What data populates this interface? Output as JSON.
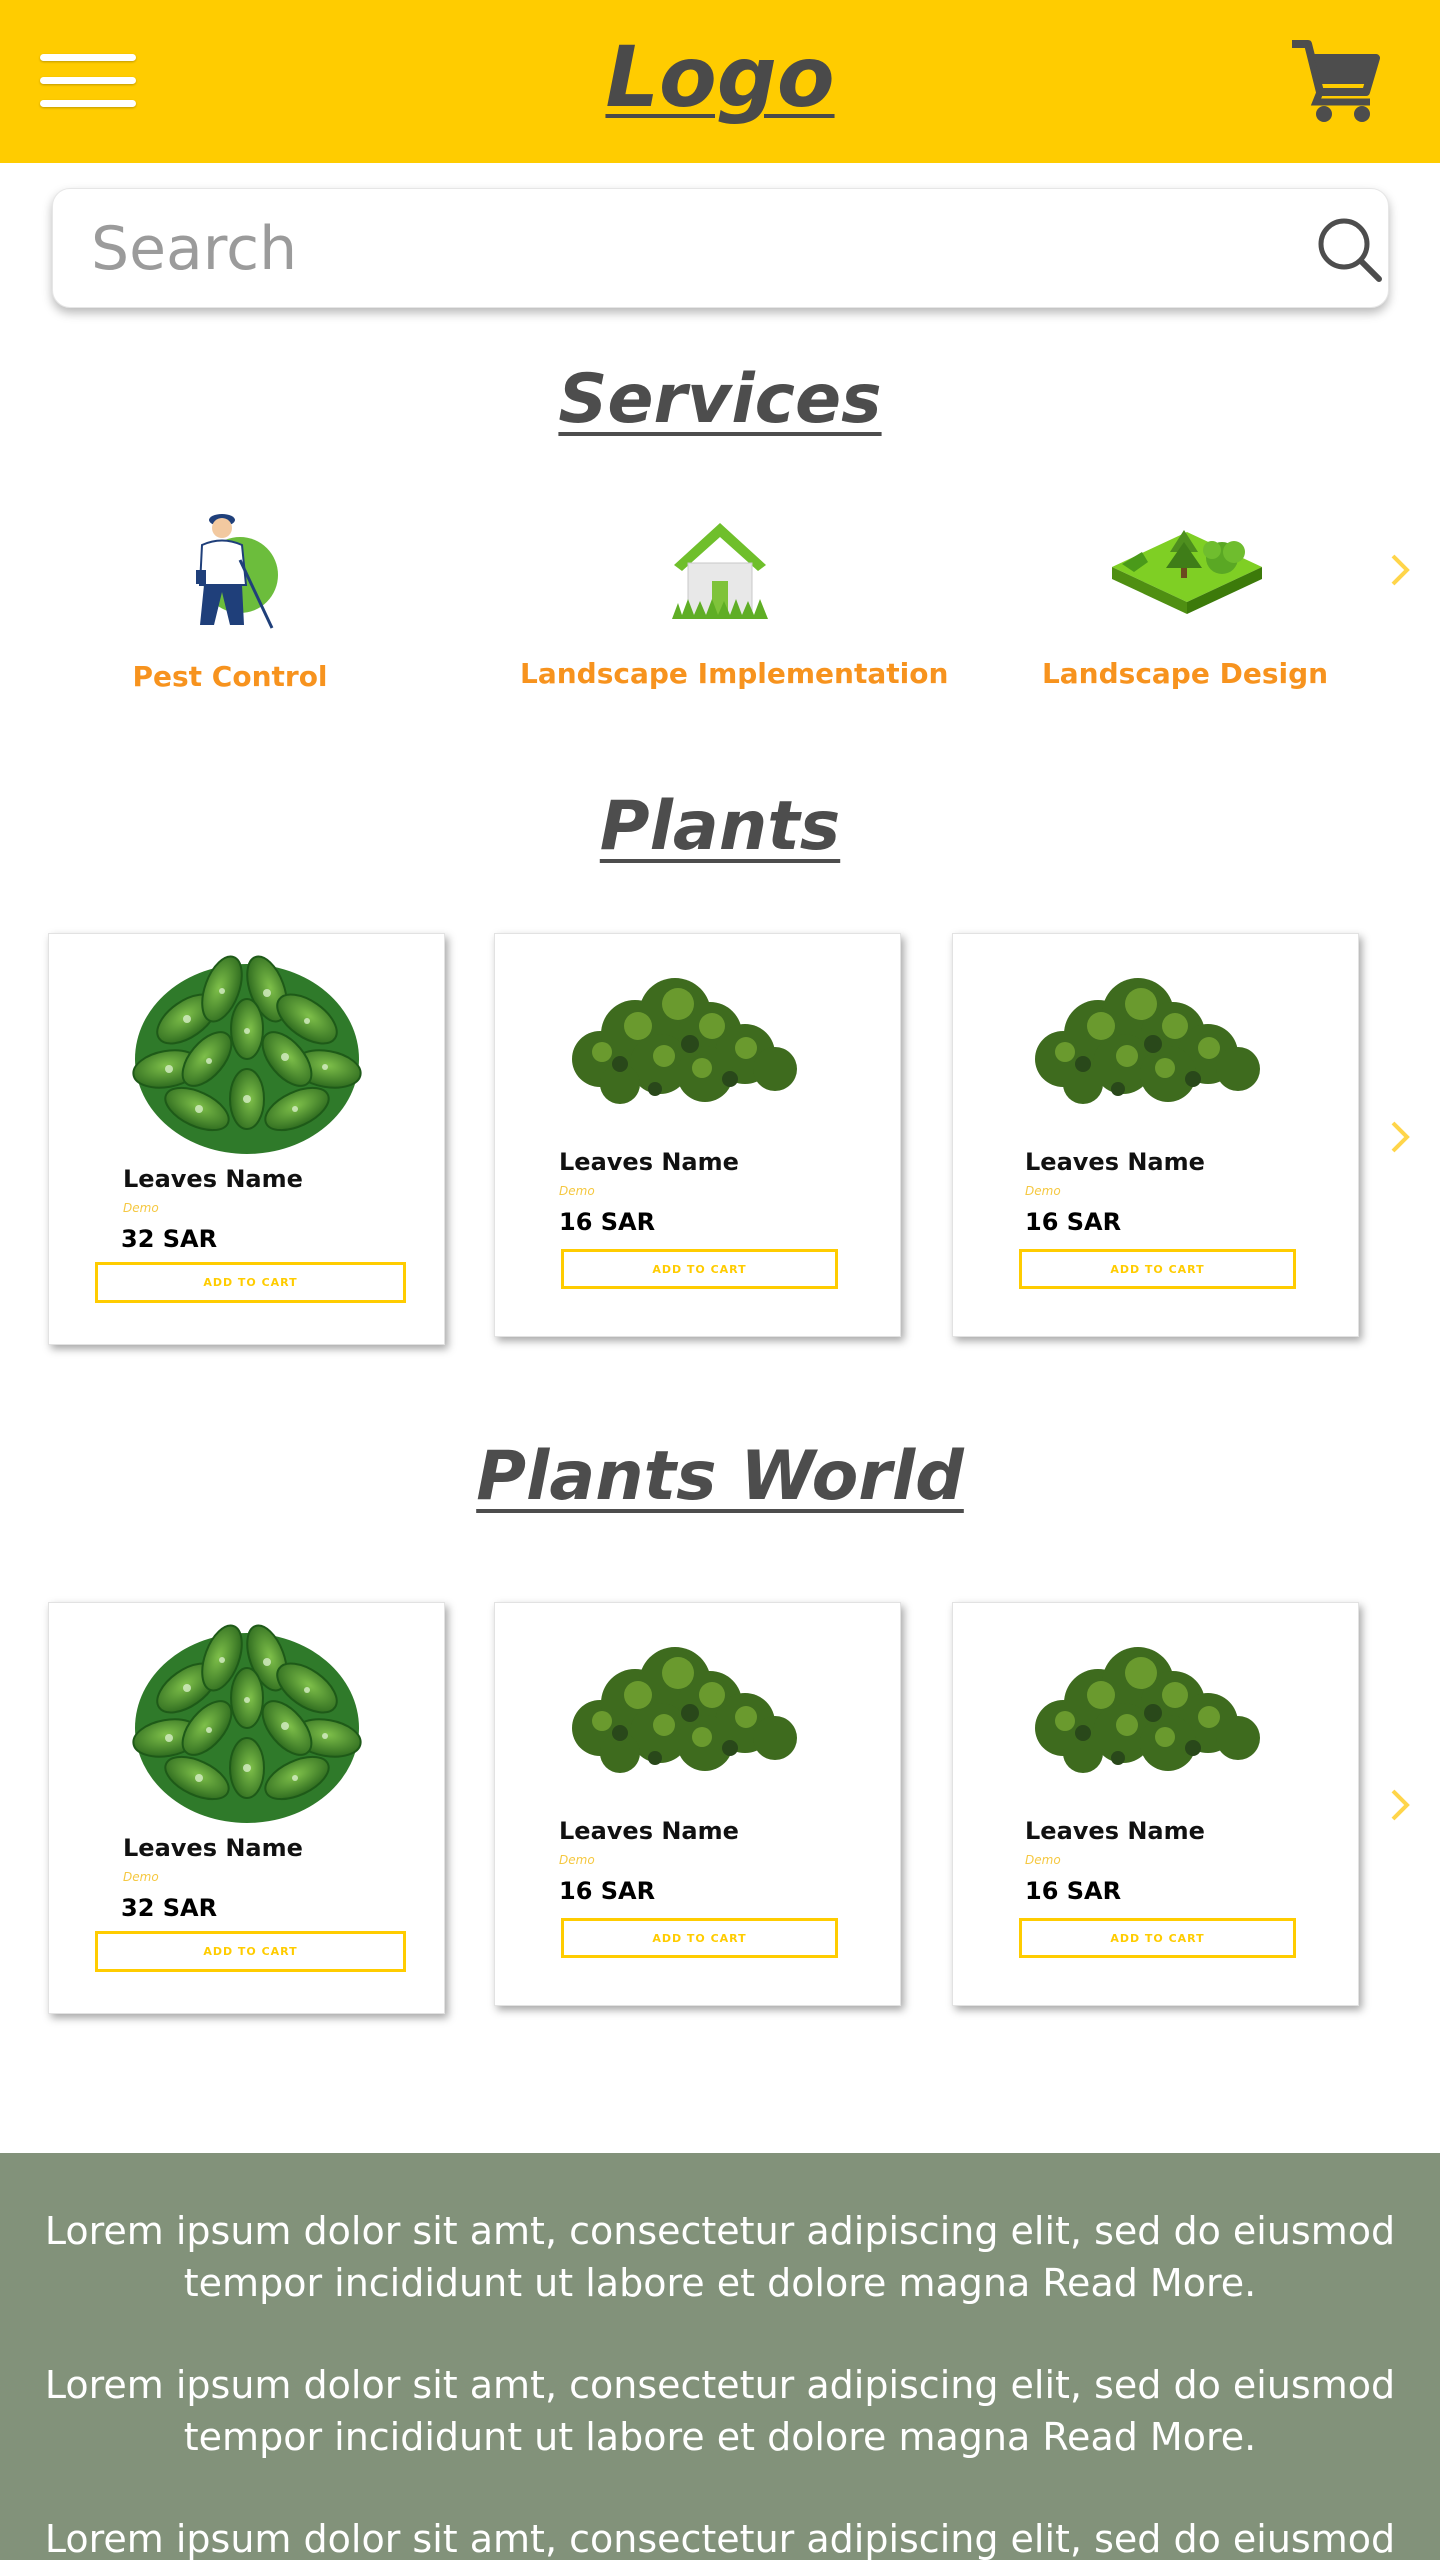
{
  "header": {
    "logo": "Logo",
    "background": "#ffcc00",
    "menu_icon": "hamburger-menu-icon",
    "cart_icon": "shopping-cart-icon"
  },
  "search": {
    "placeholder": "Search",
    "icon": "search-icon"
  },
  "services": {
    "title": "Services",
    "items": [
      {
        "label": "Pest Control",
        "icon": "pest-control-worker-icon"
      },
      {
        "label": "Landscape Implementation",
        "icon": "house-on-grass-icon"
      },
      {
        "label": "Landscape Design",
        "icon": "garden-trees-icon"
      }
    ],
    "next_icon": "chevron-right-icon"
  },
  "plants": {
    "title": "Plants",
    "products": [
      {
        "name": "Leaves Name",
        "tag": "Demo",
        "price": "32 SAR",
        "button": "ADD TO CART",
        "image": "dieffenbachia-plant"
      },
      {
        "name": "Leaves Name",
        "tag": "Demo",
        "price": "16 SAR",
        "button": "ADD TO CART",
        "image": "green-shrub"
      },
      {
        "name": "Leaves Name",
        "tag": "Demo",
        "price": "16 SAR",
        "button": "ADD TO CART",
        "image": "green-shrub"
      }
    ]
  },
  "plants_world": {
    "title": "Plants World",
    "products": [
      {
        "name": "Leaves Name",
        "tag": "Demo",
        "price": "32 SAR",
        "button": "ADD TO CART",
        "image": "dieffenbachia-plant"
      },
      {
        "name": "Leaves Name",
        "tag": "Demo",
        "price": "16 SAR",
        "button": "ADD TO CART",
        "image": "green-shrub"
      },
      {
        "name": "Leaves Name",
        "tag": "Demo",
        "price": "16 SAR",
        "button": "ADD TO CART",
        "image": "green-shrub"
      }
    ]
  },
  "footer": {
    "background": "#82927a",
    "paragraphs": [
      "Lorem ipsum dolor sit amt, consectetur adipiscing elit, sed do eiusmod tempor incididunt ut labore et dolore magna Read More.",
      "Lorem ipsum dolor sit amt, consectetur adipiscing elit, sed do eiusmod tempor incididunt ut labore et dolore magna Read More.",
      "Lorem ipsum dolor sit amt, consectetur adipiscing elit, sed do eiusmod"
    ]
  },
  "colors": {
    "accent": "#ffcc00",
    "service_label": "#f7931e",
    "title_text": "#4d4d4d"
  }
}
